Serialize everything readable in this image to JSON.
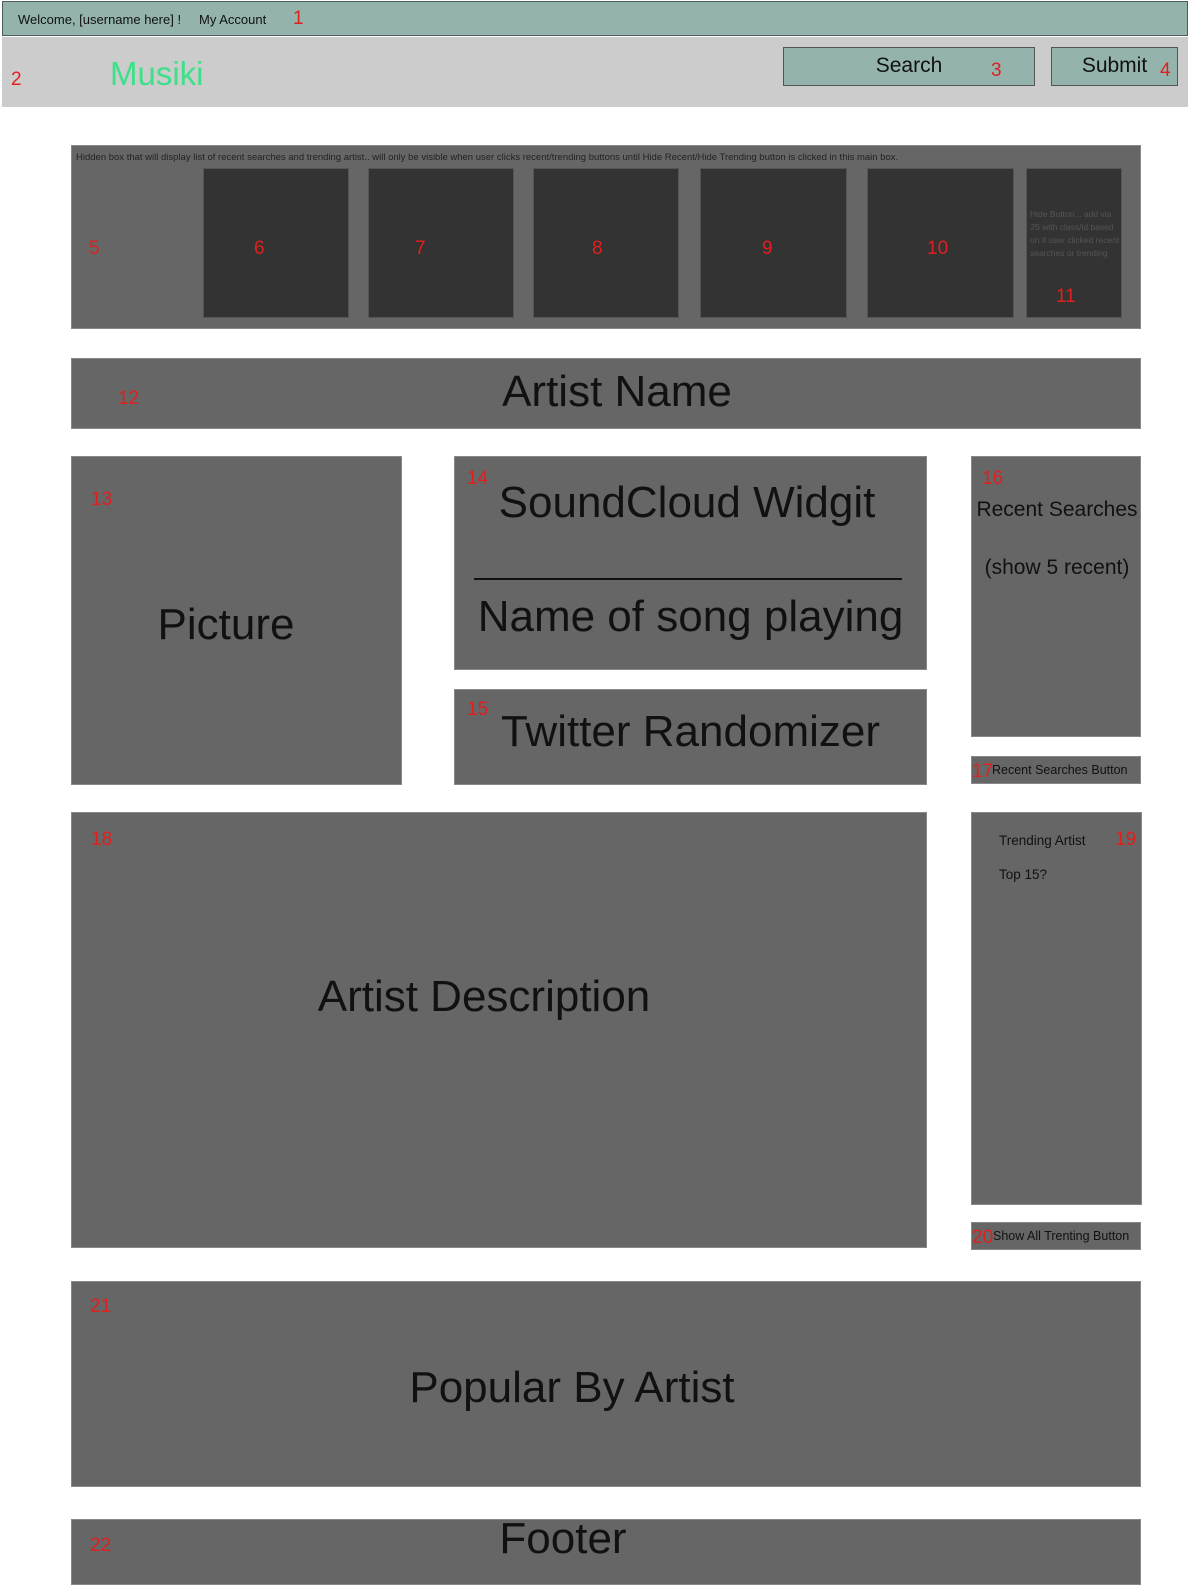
{
  "top_bar": {
    "welcome": "Welcome, [username here] !",
    "my_account": "My Account"
  },
  "header": {
    "logo": "Musiki",
    "search_label": "Search",
    "submit_label": "Submit"
  },
  "hidden_box": {
    "note": "Hidden box that will display list of recent searches and trending artist.. will only be visible when user clicks recent/trending buttons until Hide Recent/Hide Trending button is clicked in this main box.",
    "hide_button_text": "Hide Button... add via JS with class/id based on if user clicked recent searches or trending"
  },
  "artist_name": "Artist Name",
  "picture": "Picture",
  "soundcloud": {
    "title": "SoundCloud Widgit",
    "song": "Name of song playing"
  },
  "twitter": "Twitter Randomizer",
  "recent_searches": {
    "title": "Recent Searches",
    "subtitle": "(show 5 recent)",
    "button": "Recent Searches Button"
  },
  "artist_description": "Artist Description",
  "trending": {
    "title": "Trending Artist",
    "subtitle": "Top 15?",
    "button": "Show All Trenting Button"
  },
  "popular_by_artist": "Popular By Artist",
  "footer": "Footer",
  "numbers": {
    "n1": "1",
    "n2": "2",
    "n3": "3",
    "n4": "4",
    "n5": "5",
    "n6": "6",
    "n7": "7",
    "n8": "8",
    "n9": "9",
    "n10": "10",
    "n11": "11",
    "n12": "12",
    "n13": "13",
    "n14": "14",
    "n15": "15",
    "n16": "16",
    "n17": "17",
    "n18": "18",
    "n19": "19",
    "n20": "20",
    "n21": "21",
    "n22": "22"
  },
  "colors": {
    "top_bar": "#93b3ac",
    "header": "#cccccc",
    "panel": "#666666",
    "tile": "#333333",
    "logo": "#3ee08a",
    "label_number": "#e0201e"
  }
}
